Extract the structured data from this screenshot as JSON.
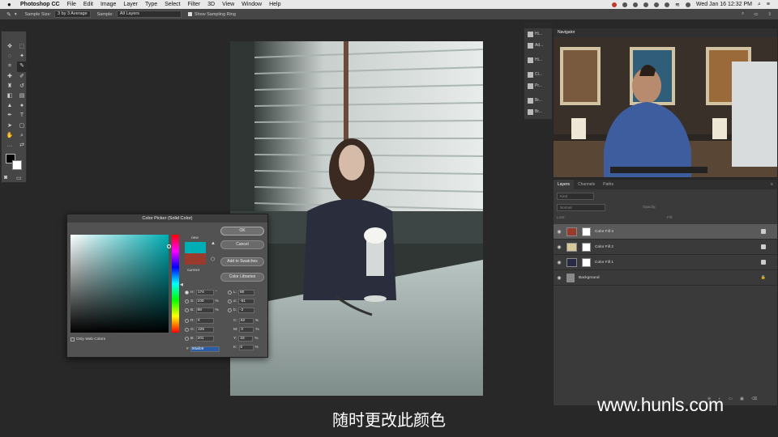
{
  "menubar": {
    "app_name": "Photoshop CC",
    "items": [
      "File",
      "Edit",
      "Image",
      "Layer",
      "Type",
      "Select",
      "Filter",
      "3D",
      "View",
      "Window",
      "Help"
    ],
    "clock": "Wed Jan 16  12:32 PM"
  },
  "options": {
    "sample_size_label": "Sample Size:",
    "sample_size_value": "3 by 3 Average",
    "sample_label": "Sample:",
    "sample_value": "All Layers",
    "show_ring_label": "Show Sampling Ring"
  },
  "dock": {
    "items": [
      "Hi...",
      "Ad...",
      "Hi...",
      "Cl...",
      "Pr...",
      "Br...",
      "Br..."
    ]
  },
  "navigator": {
    "tab": "Navigator"
  },
  "layers": {
    "tabs": [
      "Layers",
      "Channels",
      "Paths"
    ],
    "kind_placeholder": "Kind",
    "blend_mode": "Normal",
    "opacity_label": "Opacity:",
    "lock_label": "Lock:",
    "fill_label": "Fill:",
    "rows": [
      {
        "name": "Color Fill 3",
        "color": "#9a3a2c",
        "active": true
      },
      {
        "name": "Color Fill 2",
        "color": "#d8c79a",
        "active": false
      },
      {
        "name": "Color Fill 1",
        "color": "#2a2a44",
        "active": false
      },
      {
        "name": "Background",
        "color": "#8a8a8a",
        "active": false
      }
    ]
  },
  "picker": {
    "title": "Color Picker (Solid Color)",
    "ok": "OK",
    "cancel": "Cancel",
    "add_swatches": "Add to Swatches",
    "color_libraries": "Color Libraries",
    "new_label": "new",
    "current_label": "current",
    "new_color": "#00afb5",
    "current_color": "#9a3a2c",
    "only_web": "Only Web Colors",
    "fields": {
      "H": "174",
      "S": "100",
      "B": "88",
      "R": "0",
      "G": "225",
      "Bl": "201",
      "L": "80",
      "a": "-51",
      "b": "-2",
      "C": "62",
      "M": "0",
      "Y": "33",
      "K": "0",
      "hex": "00afc9"
    },
    "units": {
      "deg": "°",
      "pct": "%"
    }
  },
  "subtitle": "随时更改此颜色",
  "watermark": "www.hunls.com"
}
